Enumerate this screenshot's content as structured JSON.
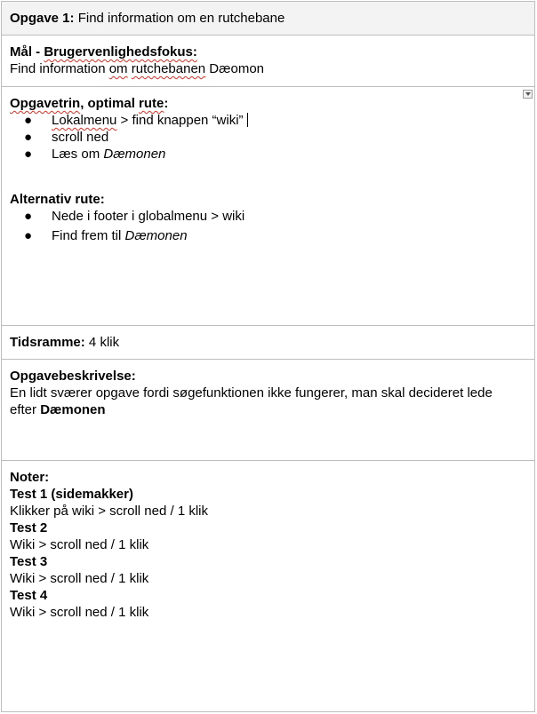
{
  "header": {
    "task_label": "Opgave 1:",
    "task_title": "Find information om en rutchebane"
  },
  "goal": {
    "heading_prefix": "Mål - ",
    "heading_focus": "Brugervenlighedsfokus:",
    "text_a": "Find information ",
    "text_om": "om",
    "text_b": " ",
    "text_rutchebanen": "rutchebanen",
    "text_c": " Dæomon"
  },
  "steps": {
    "heading_a": "Opgavetrin",
    "heading_b": ", optimal ",
    "heading_c": "rute",
    "heading_d": ":",
    "bullet": "●",
    "item1_a": "Lokalmenu",
    "item1_b": " > find knappen “wiki”",
    "item2": "scroll ned",
    "item3_a": "Læs om ",
    "item3_b": "Dæmonen",
    "alt_heading": "Alternativ rute:",
    "alt1": "Nede i footer i globalmenu > wiki",
    "alt2_a": "Find frem til ",
    "alt2_b": "Dæmonen"
  },
  "timeframe": {
    "label": "Tidsramme:",
    "value": " 4 klik"
  },
  "description": {
    "heading": "Opgavebeskrivelse:",
    "line1": "En lidt sværer opgave fordi søgefunktionen ikke fungerer, man skal decideret lede",
    "line2_a": "efter ",
    "line2_b": "Dæmonen"
  },
  "notes": {
    "heading": "Noter:",
    "tests": [
      {
        "title": "Test 1 (sidemakker)",
        "result": "Klikker på wiki > scroll ned / 1 klik"
      },
      {
        "title": "Test 2",
        "result": "Wiki > scroll ned / 1 klik"
      },
      {
        "title": "Test 3",
        "result": "Wiki > scroll ned / 1 klik"
      },
      {
        "title": "Test 4",
        "result": "Wiki > scroll ned / 1 klik"
      }
    ]
  },
  "colors": {
    "border": "#bdbdbd",
    "header_bg": "#f3f3f3",
    "spellcheck": "#d93025"
  },
  "icons": {
    "dropdown": "chevron-down-icon"
  }
}
